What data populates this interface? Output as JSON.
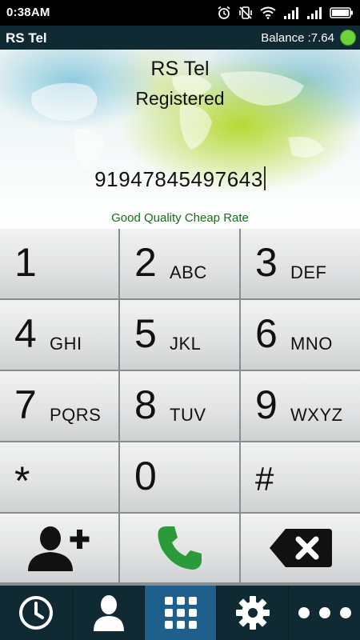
{
  "status_bar": {
    "time": "0:38AM",
    "icons": [
      "alarm-icon",
      "vibrate-icon",
      "wifi-icon",
      "signal-icon",
      "signal-icon",
      "battery-icon"
    ]
  },
  "app_bar": {
    "title": "RS Tel",
    "balance": "Balance :7.64",
    "status_color": "#6fd23c"
  },
  "header": {
    "name": "RS Tel",
    "registration_status": "Registered",
    "dialed_number": "91947845497643",
    "tagline": "Good Quality Cheap Rate"
  },
  "keypad": {
    "keys": [
      {
        "digit": "1",
        "letters": ""
      },
      {
        "digit": "2",
        "letters": "ABC"
      },
      {
        "digit": "3",
        "letters": "DEF"
      },
      {
        "digit": "4",
        "letters": "GHI"
      },
      {
        "digit": "5",
        "letters": "JKL"
      },
      {
        "digit": "6",
        "letters": "MNO"
      },
      {
        "digit": "7",
        "letters": "PQRS"
      },
      {
        "digit": "8",
        "letters": "TUV"
      },
      {
        "digit": "9",
        "letters": "WXYZ"
      },
      {
        "digit": "*",
        "letters": ""
      },
      {
        "digit": "0",
        "letters": ""
      },
      {
        "digit": "#",
        "letters": ""
      }
    ],
    "actions": [
      "add-contact-icon",
      "call-icon",
      "backspace-icon"
    ],
    "call_color": "#2a9a3a"
  },
  "bottom_nav": {
    "items": [
      "recent-calls-icon",
      "contacts-icon",
      "dialpad-icon",
      "settings-icon",
      "more-icon"
    ],
    "active": "dialpad-icon"
  }
}
